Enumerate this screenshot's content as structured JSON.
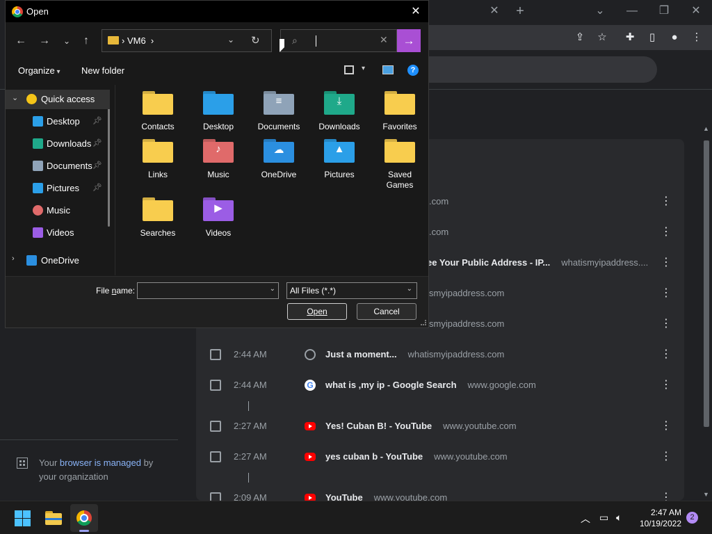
{
  "dialog": {
    "title": "Open",
    "breadcrumb": [
      "VM6"
    ],
    "search_placeholder": "",
    "organize_label": "Organize",
    "new_folder_label": "New folder",
    "nav_items": [
      {
        "label": "Quick access",
        "icon": "star-icon"
      },
      {
        "label": "Desktop",
        "icon": "desktop-icon",
        "pinned": true
      },
      {
        "label": "Downloads",
        "icon": "download-icon",
        "pinned": true
      },
      {
        "label": "Documents",
        "icon": "documents-icon",
        "pinned": true
      },
      {
        "label": "Pictures",
        "icon": "pictures-icon",
        "pinned": true
      },
      {
        "label": "Music",
        "icon": "music-icon"
      },
      {
        "label": "Videos",
        "icon": "videos-icon"
      },
      {
        "label": "OneDrive",
        "icon": "cloud-icon"
      }
    ],
    "folders": [
      {
        "name": "Contacts",
        "color": "#f8cd4e",
        "glyph": ""
      },
      {
        "name": "Desktop",
        "color": "#2b9fe8",
        "glyph": ""
      },
      {
        "name": "Documents",
        "color": "#8fa3b8",
        "glyph": "≡"
      },
      {
        "name": "Downloads",
        "color": "#1fa98a",
        "glyph": "⤓"
      },
      {
        "name": "Favorites",
        "color": "#f8cd4e",
        "glyph": ""
      },
      {
        "name": "Links",
        "color": "#f8cd4e",
        "glyph": ""
      },
      {
        "name": "Music",
        "color": "#e06a6a",
        "glyph": "♪"
      },
      {
        "name": "OneDrive",
        "color": "#2b8fe0",
        "glyph": "☁"
      },
      {
        "name": "Pictures",
        "color": "#2b9fe8",
        "glyph": "▲"
      },
      {
        "name": "Saved Games",
        "color": "#f8cd4e",
        "glyph": ""
      },
      {
        "name": "Searches",
        "color": "#f8cd4e",
        "glyph": ""
      },
      {
        "name": "Videos",
        "color": "#9b5de5",
        "glyph": "▶"
      }
    ],
    "file_name_label": "File name:",
    "file_name_value": "",
    "file_type": "All Files (*.*)",
    "open_label": "Open",
    "cancel_label": "Cancel"
  },
  "chrome": {
    "managed_text_1": "Your ",
    "managed_link": "browser is managed",
    "managed_text_2": " by your organization",
    "history_rows": [
      {
        "time": "",
        "title": "",
        "partial": ".com"
      },
      {
        "time": "",
        "title": "",
        "partial": ".com"
      },
      {
        "time": "",
        "title": "ee Your Public Address - IP...",
        "domain": "whatismyipaddress...."
      },
      {
        "time": "",
        "title": "",
        "partial": "smyipaddress.com"
      },
      {
        "time": "",
        "title": "",
        "partial": "smyipaddress.com"
      },
      {
        "time": "2:44 AM",
        "title": "Just a moment...",
        "domain": "whatismyipaddress.com",
        "favicon": "globe"
      },
      {
        "time": "2:44 AM",
        "title": "what is ,my ip - Google Search",
        "domain": "www.google.com",
        "favicon": "google"
      },
      {
        "time": "2:27 AM",
        "title": "Yes! Cuban B! - YouTube",
        "domain": "www.youtube.com",
        "favicon": "youtube"
      },
      {
        "time": "2:27 AM",
        "title": "yes cuban b - YouTube",
        "domain": "www.youtube.com",
        "favicon": "youtube"
      },
      {
        "time": "2:09 AM",
        "title": "YouTube",
        "domain": "www.youtube.com",
        "favicon": "youtube"
      }
    ]
  },
  "taskbar": {
    "time": "2:47 AM",
    "date": "10/19/2022",
    "notification_count": "2"
  },
  "colors": {
    "accent_purple": "#a94fd4",
    "folder_yellow": "#f8cd4e",
    "link_blue": "#8ab4f8"
  }
}
